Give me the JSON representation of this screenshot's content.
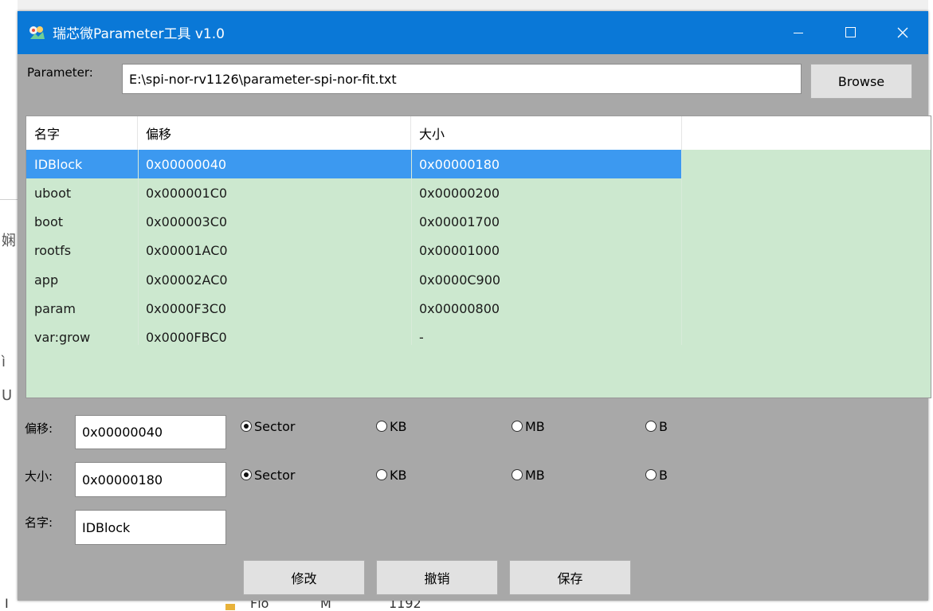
{
  "window": {
    "title": "瑞芯微Parameter工具 v1.0",
    "accent_color": "#0a78d7",
    "controls": [
      "minimize-icon",
      "maximize-icon",
      "close-icon"
    ]
  },
  "parameter": {
    "label": "Parameter:",
    "path": "E:\\spi-nor-rv1126\\parameter-spi-nor-fit.txt",
    "browse_label": "Browse"
  },
  "table": {
    "columns": [
      "名字",
      "偏移",
      "大小"
    ],
    "selected_index": 0,
    "rows": [
      {
        "name": "IDBlock",
        "offset": "0x00000040",
        "size": "0x00000180"
      },
      {
        "name": "uboot",
        "offset": "0x000001C0",
        "size": "0x00000200"
      },
      {
        "name": "boot",
        "offset": "0x000003C0",
        "size": "0x00001700"
      },
      {
        "name": "rootfs",
        "offset": "0x00001AC0",
        "size": "0x00001000"
      },
      {
        "name": "app",
        "offset": "0x00002AC0",
        "size": "0x0000C900"
      },
      {
        "name": "param",
        "offset": "0x0000F3C0",
        "size": "0x00000800"
      },
      {
        "name": "var:grow",
        "offset": "0x0000FBC0",
        "size": "-"
      }
    ]
  },
  "form": {
    "offset": {
      "label": "偏移:",
      "value": "0x00000040",
      "units": [
        "Sector",
        "KB",
        "MB",
        "B"
      ],
      "selected_unit": "Sector"
    },
    "size": {
      "label": "大小:",
      "value": "0x00000180",
      "units": [
        "Sector",
        "KB",
        "MB",
        "B"
      ],
      "selected_unit": "Sector"
    },
    "name": {
      "label": "名字:",
      "value": "IDBlock"
    }
  },
  "buttons": {
    "modify": "修改",
    "undo": "撤销",
    "save": "保存"
  },
  "background": {
    "left_glyphs": [
      "娴",
      "ì",
      "U"
    ],
    "bottom_glyphs": [
      "I",
      "Flo",
      "M",
      "1192"
    ]
  }
}
